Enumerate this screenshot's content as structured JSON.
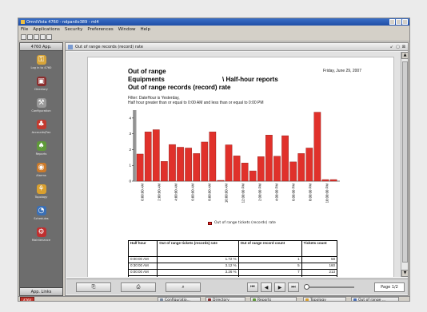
{
  "window": {
    "title": "OmniVista 4760 - ndpanilo389 - ml4"
  },
  "menu": [
    "File",
    "Applications",
    "Security",
    "Preferences",
    "Window",
    "Help"
  ],
  "left_panel": {
    "header": "4760 App.",
    "footer": "App. Links",
    "items": [
      {
        "label": "Log in to 4760",
        "icon": "key-icon",
        "color": "#d6a43a",
        "glyph": "⚿"
      },
      {
        "label": "Directory",
        "icon": "book-icon",
        "color": "#8a2d2d",
        "glyph": "▣"
      },
      {
        "label": "Configuration",
        "icon": "wrench-icon",
        "color": "#9a9a9a",
        "glyph": "⚒"
      },
      {
        "label": "Accounts/Fax",
        "icon": "users-icon",
        "color": "#c33a2f",
        "glyph": "♣"
      },
      {
        "label": "Reports",
        "icon": "report-icon",
        "color": "#5f9a3a",
        "glyph": "♠"
      },
      {
        "label": "Alarms",
        "icon": "alarm-icon",
        "color": "#cc7a2a",
        "glyph": "◉"
      },
      {
        "label": "Topology",
        "icon": "topology-icon",
        "color": "#d9a02f",
        "glyph": "⚘"
      },
      {
        "label": "Schedules",
        "icon": "schedule-icon",
        "color": "#3a6fb5",
        "glyph": "◔"
      },
      {
        "label": "Maintenance",
        "icon": "maintenance-icon",
        "color": "#c02f2f",
        "glyph": "⚙"
      }
    ]
  },
  "inner_window": {
    "title": "Out of range records (record) rate"
  },
  "report": {
    "title_lines": [
      "Out of range",
      "Equipments",
      "Out of range records (record) rate"
    ],
    "subtitle_right": "\\ Half-hour reports",
    "date": "Friday, June 29, 2007",
    "filter_line1": "Filter: DateHour  is Yesterday,",
    "filter_line2": "Half hour  greater than or equal to 0:00 AM and less than or equal to 0:00 PM"
  },
  "chart_data": {
    "type": "bar",
    "categories": [
      "0:00:00 AM",
      "2:00:00 AM",
      "4:00:00 AM",
      "6:00:00 AM",
      "8:00:00 AM",
      "10:00:00 AM",
      "12:00:00 PM",
      "2:00:00 PM",
      "4:00:00 PM",
      "6:00:00 PM",
      "8:00:00 PM",
      "10:00:00 PM"
    ],
    "values": [
      1.72,
      3.12,
      3.26,
      1.25,
      2.32,
      2.15,
      2.1,
      1.75,
      2.48,
      3.12,
      0.05,
      2.3,
      1.6,
      1.15,
      0.65,
      1.55,
      2.92,
      1.58,
      2.88,
      1.22,
      1.75,
      2.1,
      4.37,
      0.1,
      0.1
    ],
    "ylim": [
      0,
      4.5
    ],
    "yticks": [
      0,
      1,
      2,
      3,
      4
    ],
    "legend": "Out of range  tickets (records) rate",
    "color": "#e0312b"
  },
  "table": {
    "headers": [
      "Half hour",
      "Out of range tickets (records) rate",
      "Out of range record count",
      "Tickets count"
    ],
    "rows": [
      [
        "0:00:00 AM",
        "1.72 %",
        "1",
        "58"
      ],
      [
        "0:30:00 AM",
        "3.12 %",
        "5",
        "160"
      ],
      [
        "0:00:00 AM",
        "3.26 %",
        "7",
        "213"
      ],
      [
        "0:00:00 AM",
        "",
        "",
        ""
      ]
    ]
  },
  "bottom_bar": {
    "page_label": "Page 1/2"
  },
  "taskbar": {
    "logo": "4760",
    "tasks": [
      {
        "label": "Configuratio...",
        "color": "#7a8aa0"
      },
      {
        "label": "Directory",
        "color": "#8a2d2d"
      },
      {
        "label": "Reports",
        "color": "#5f9a3a"
      },
      {
        "label": "Topology",
        "color": "#d9a02f"
      },
      {
        "label": "Out of range ...",
        "color": "#4a6fb5"
      }
    ]
  }
}
